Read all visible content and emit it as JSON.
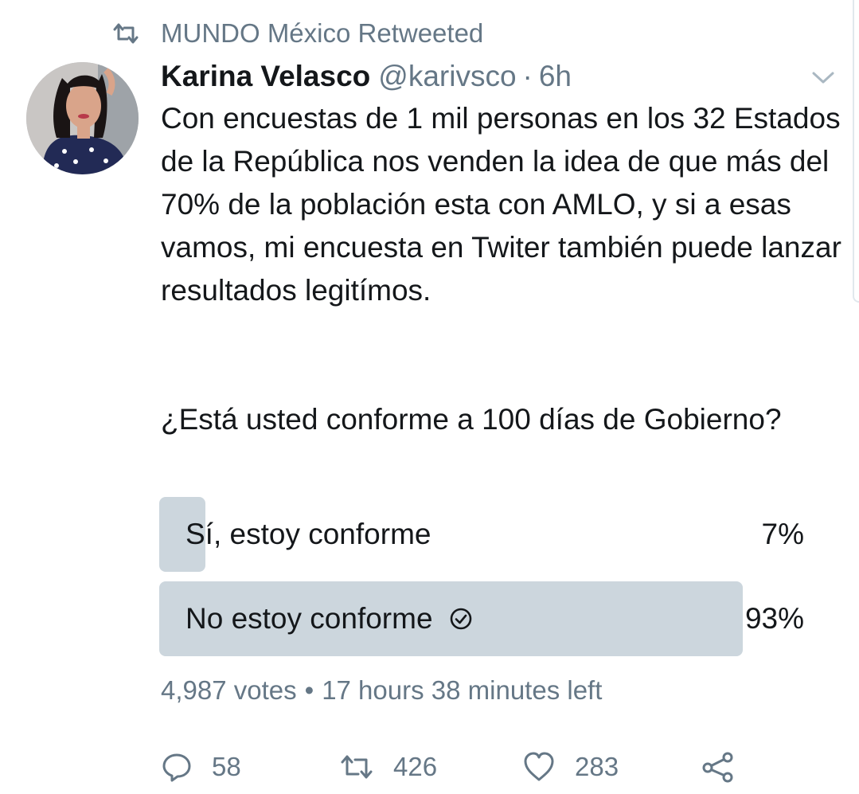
{
  "retweet_context": {
    "text": "MUNDO México Retweeted",
    "icon": "retweet-icon"
  },
  "tweet": {
    "author_name": "Karina Velasco",
    "author_handle": "@karivsco",
    "separator": "·",
    "time": "6h",
    "text": "Con encuestas de 1 mil personas en los 32 Estados de la República nos venden la idea de que más del 70% de la población esta con AMLO, y si a esas vamos, mi encuesta en Twiter también puede lanzar resultados legitímos.",
    "question": "¿Está usted conforme a 100 días de Gobierno?"
  },
  "poll": {
    "options": [
      {
        "label": "Sí, estoy conforme",
        "percent": "7%",
        "fraction": 0.07,
        "winner": false
      },
      {
        "label": "No estoy conforme",
        "percent": "93%",
        "fraction": 0.93,
        "winner": true
      }
    ],
    "votes": "4,987 votes",
    "separator": "•",
    "time_left": "17 hours 38 minutes left"
  },
  "actions": {
    "replies": "58",
    "retweets": "426",
    "likes": "283"
  },
  "colors": {
    "text": "#14171a",
    "secondary": "#657786",
    "poll_bar": "#ccd6dd"
  }
}
